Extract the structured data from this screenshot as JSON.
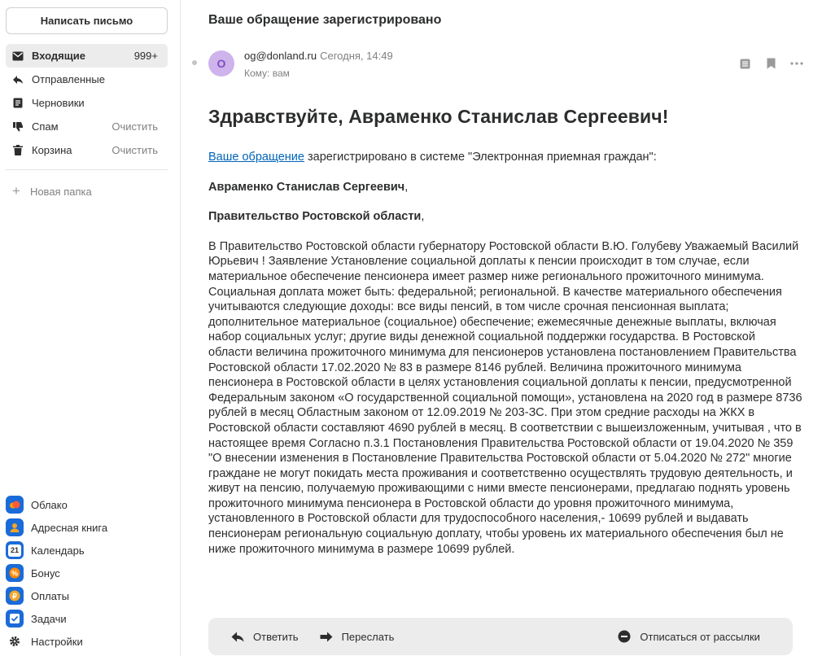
{
  "compose_label": "Написать письмо",
  "folders": [
    {
      "label": "Входящие",
      "aux": "999+",
      "icon": "inbox-icon"
    },
    {
      "label": "Отправленные",
      "aux": "",
      "icon": "sent-icon"
    },
    {
      "label": "Черновики",
      "aux": "",
      "icon": "drafts-icon"
    },
    {
      "label": "Спам",
      "aux": "Очистить",
      "icon": "spam-icon"
    },
    {
      "label": "Корзина",
      "aux": "Очистить",
      "icon": "trash-icon"
    }
  ],
  "new_folder": "Новая папка",
  "apps": [
    {
      "label": "Облако",
      "color": "#ff9e00"
    },
    {
      "label": "Адресная книга",
      "color": "#f5a623"
    },
    {
      "label": "Календарь",
      "color": "#2b6fd6",
      "glyph": "21"
    },
    {
      "label": "Бонус",
      "color": "#ff8a00"
    },
    {
      "label": "Оплаты",
      "color": "#f5a623"
    },
    {
      "label": "Задачи",
      "color": "#2b6fd6"
    }
  ],
  "settings_label": "Настройки",
  "message": {
    "subject": "Ваше обращение зарегистрировано",
    "avatar_letter": "О",
    "from_address": "og@donland.ru",
    "date": "Сегодня, 14:49",
    "to": "Кому: вам",
    "greeting": "Здравствуйте, Авраменко Станислав Сергеевич!",
    "link_text": "Ваше обращение",
    "intro_rest": " зарегистрировано в системе \"Электронная приемная граждан\":",
    "name_line": "Авраменко Станислав Сергеевич",
    "org_line": "Правительство Ростовской области",
    "comma": ",",
    "text": "В Правительство Ростовской области губернатору Ростовской области В.Ю. Голубеву Уважаемый Василий Юрьевич ! Заявление Установление социальной доплаты к пенсии происходит в том случае, если материальное обеспечение пенсионера имеет размер ниже регионального прожиточного минимума. Социальная доплата может быть: федеральной; региональной. В качестве материального обеспечения учитываются следующие доходы: все виды пенсий, в том числе срочная пенсионная выплата; дополнительное материальное (социальное) обеспечение; ежемесячные денежные выплаты, включая набор социальных услуг; другие виды денежной социальной поддержки государства. В Ростовской области величина прожиточного минимума для пенсионеров установлена постановлением Правительства Ростовской области 17.02.2020 № 83 в размере 8146 рублей. Величина прожиточного минимума пенсионера в Ростовской области в целях установления социальной доплаты к пенсии, предусмотренной Федеральным законом «О государственной социальной помощи», установлена на 2020 год в размере 8736 рублей в месяц Областным законом от 12.09.2019 № 203-ЗС. При этом средние расходы на ЖКХ в Ростовской области составляют 4690 рублей в месяц. В соответствии с вышеизложенным, учитывая , что в настоящее время Согласно п.3.1 Постановления Правительства Ростовской области от 19.04.2020 № 359 \"О внесении изменения в Постановление Правительства Ростовской области от 5.04.2020 № 272\" многие граждане не могут покидать места проживания и соответственно осуществлять трудовую деятельность, и живут на пенсию, получаемую проживающими с ними вместе пенсионерами, предлагаю поднять уровень прожиточного минимума пенсионера в Ростовской области до уровня прожиточного минимума, установленного в Ростовской области для трудоспособного населения,- 10699 рублей и выдавать пенсионерам региональную социальную доплату, чтобы уровень их материального обеспечения был не ниже прожиточного минимума в размере 10699 рублей."
  },
  "actions": {
    "reply": "Ответить",
    "forward": "Переслать",
    "unsubscribe": "Отписаться от рассылки"
  }
}
